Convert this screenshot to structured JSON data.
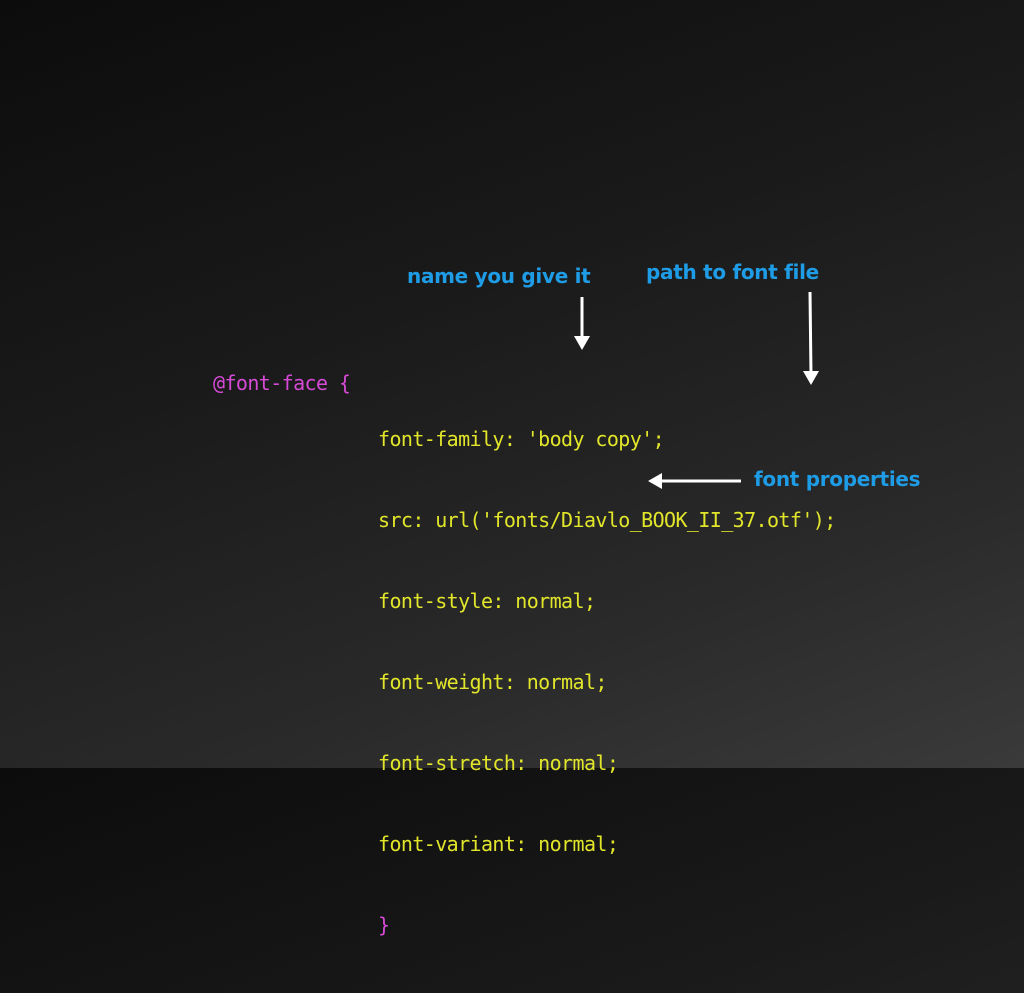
{
  "slide": {
    "annotations": {
      "name_label": "name you give it",
      "path_label": "path to font file",
      "properties_label": "font properties"
    },
    "code": {
      "selector": "@font-face {",
      "declarations": [
        "font-family: 'body copy';",
        "src: url('fonts/Diavlo_BOOK_II_37.otf');",
        "font-style: normal;",
        "font-weight: normal;",
        "font-stretch: normal;",
        "font-variant: normal;"
      ],
      "closing_brace": "}"
    },
    "colors": {
      "selector": "#d64ad6",
      "declarations": "#e2e62a",
      "annotation": "#1e9ce6",
      "arrow": "#ffffff"
    }
  }
}
